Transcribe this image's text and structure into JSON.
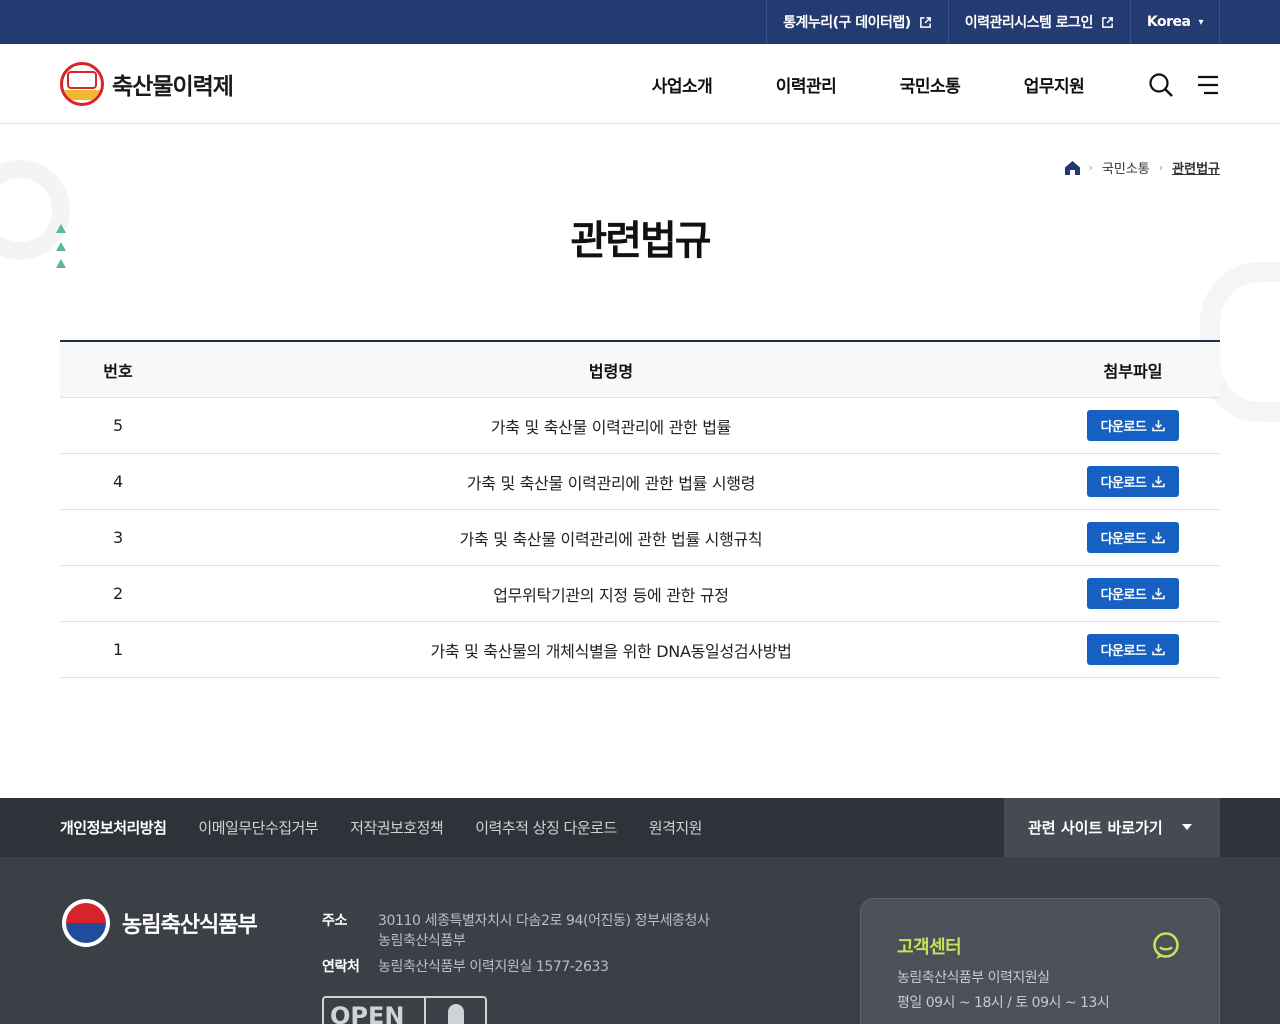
{
  "util": {
    "links": [
      {
        "label": "통계누리(구 데이터랩)",
        "icon": "external-link-icon"
      },
      {
        "label": "이력관리시스템 로그인",
        "icon": "external-link-icon"
      },
      {
        "label": "Korea",
        "icon": "chevron-down-icon"
      }
    ]
  },
  "header": {
    "logo_text": "축산물이력제",
    "nav": [
      "사업소개",
      "이력관리",
      "국민소통",
      "업무지원"
    ],
    "icons": [
      "search-icon",
      "menu-icon"
    ]
  },
  "breadcrumb": {
    "items": [
      "국민소통",
      "관련법규"
    ]
  },
  "page": {
    "title": "관련법규"
  },
  "table": {
    "headers": [
      "번호",
      "법령명",
      "첨부파일"
    ],
    "download_label": "다운로드",
    "rows": [
      {
        "no": "5",
        "name": "가축 및 축산물 이력관리에 관한 법률"
      },
      {
        "no": "4",
        "name": "가축 및 축산물 이력관리에 관한 법률 시행령"
      },
      {
        "no": "3",
        "name": "가축 및 축산물 이력관리에 관한 법률 시행규칙"
      },
      {
        "no": "2",
        "name": "업무위탁기관의 지정 등에 관한 규정"
      },
      {
        "no": "1",
        "name": "가축 및 축산물의 개체식별을 위한 DNA동일성검사방법"
      }
    ]
  },
  "footer": {
    "links": [
      "개인정보처리방침",
      "이메일무단수집거부",
      "저작권보호정책",
      "이력추적 상징 다운로드",
      "원격지원"
    ],
    "related_label": "관련 사이트 바로가기",
    "ministry": "농림축산식품부",
    "address_label": "주소",
    "address_lines": [
      "30110 세종특별자치시 다솜2로 94(어진동) 정부세종청사",
      "농림축산식품부"
    ],
    "contact_label": "연락처",
    "contact": "농림축산식품부 이력지원실 1577-2633",
    "open_badge": "OPEN",
    "cs_title": "고객센터",
    "cs_lines": [
      "농림축산식품부 이력지원실",
      "평일 09시 ~ 18시 / 토 09시 ~ 13시"
    ]
  }
}
